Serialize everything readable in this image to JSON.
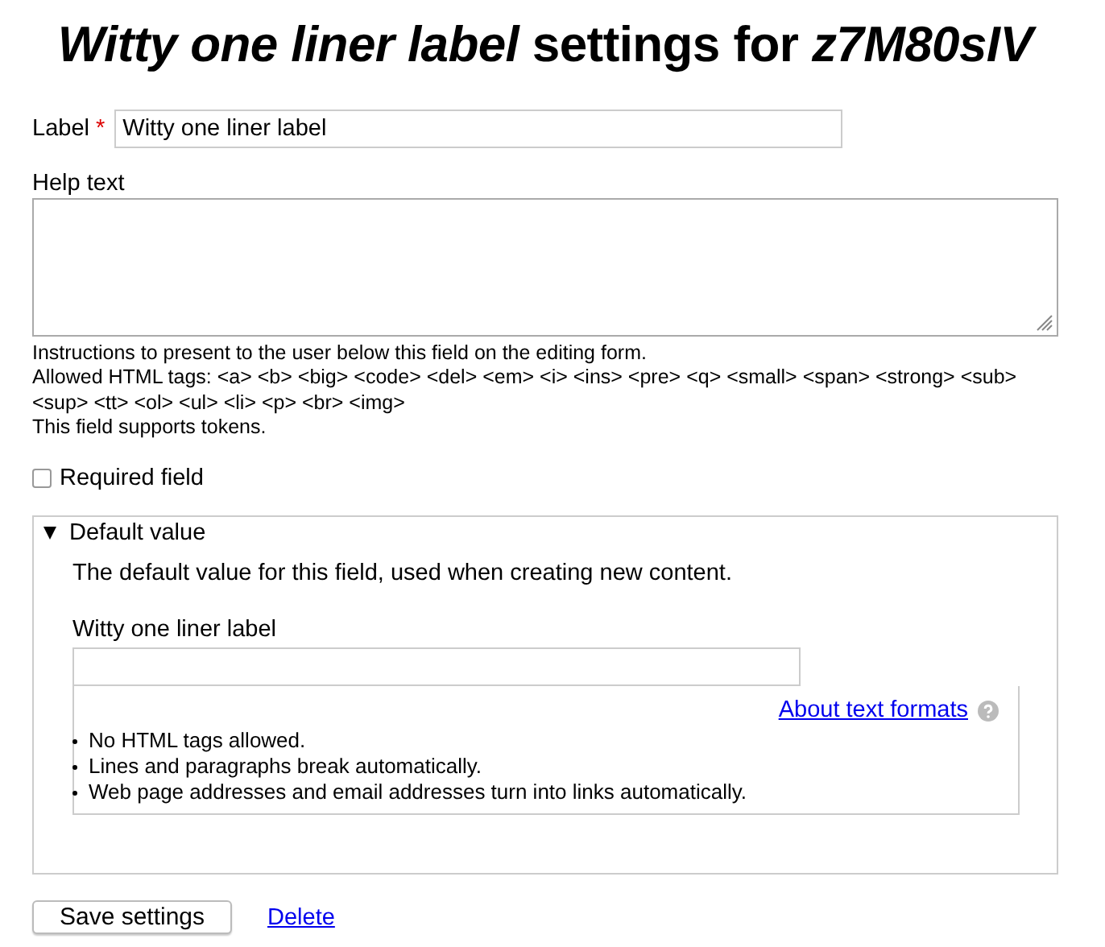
{
  "title": "*Witty one liner label* settings for *z7M80sIV*",
  "label_field": {
    "label": "Label",
    "required_mark": "*",
    "value": "Witty one liner label"
  },
  "help_field": {
    "label": "Help text",
    "descriptions": [
      "Instructions to present to the user below this field on the editing form.",
      "Allowed HTML tags: <a> <b> <big> <code> <del> <em> <i> <ins> <pre> <q> <small> <span> <strong> <sub> <sup> <tt> <ol> <ul> <li> <p> <br> <img>",
      "This field supports tokens."
    ]
  },
  "required_checkbox": {
    "label": "Required field",
    "checked": false
  },
  "default_value": {
    "summary": "Default value",
    "expanded": true,
    "description": "The default value for this field, used when creating new content.",
    "field_label": "Witty one liner label",
    "format_link": "About text formats",
    "format_tips": [
      "No HTML tags allowed.",
      "Lines and paragraphs break automatically.",
      "Web page addresses and email addresses turn into links automatically."
    ]
  },
  "actions": {
    "save": "Save settings",
    "delete": "Delete"
  }
}
